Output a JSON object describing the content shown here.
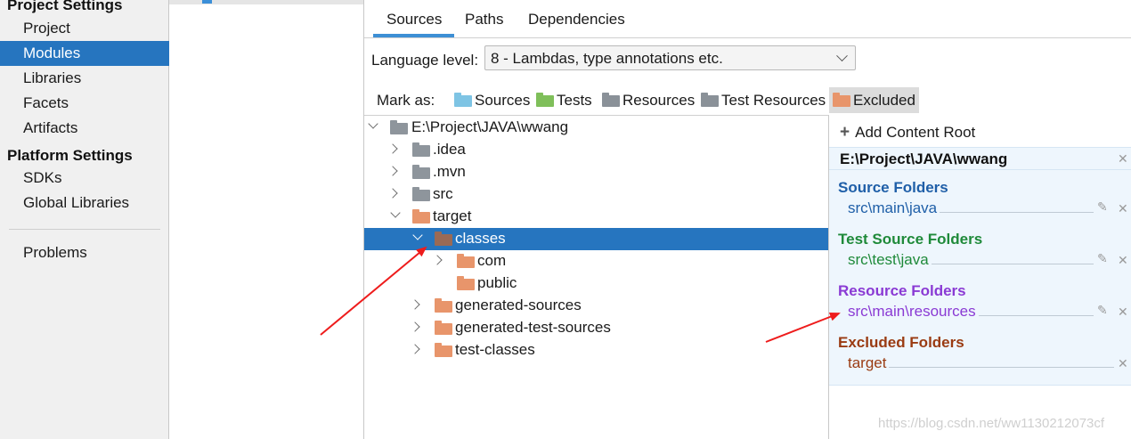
{
  "sidebar": {
    "project_settings_heading": "Project Settings",
    "project_settings_items": [
      "Project",
      "Modules",
      "Libraries",
      "Facets",
      "Artifacts"
    ],
    "platform_settings_heading": "Platform Settings",
    "platform_settings_items": [
      "SDKs",
      "Global Libraries"
    ],
    "problems": "Problems",
    "selected": "Modules"
  },
  "tabs": [
    "Sources",
    "Paths",
    "Dependencies"
  ],
  "active_tab": "Sources",
  "language_level": {
    "label": "Language level:",
    "value": "8 - Lambdas, type annotations etc."
  },
  "mark_as": {
    "label": "Mark as:",
    "buttons": [
      {
        "label": "Sources",
        "color": "#7ec4e4"
      },
      {
        "label": "Tests",
        "color": "#7fbf5a"
      },
      {
        "label": "Resources",
        "color": "#8a9198"
      },
      {
        "label": "Test Resources",
        "color": "#8a9198"
      },
      {
        "label": "Excluded",
        "color": "#e8956b"
      }
    ],
    "active": "Excluded"
  },
  "tree": {
    "root": "E:\\Project\\JAVA\\wwang",
    "items": [
      ".idea",
      ".mvn",
      "src",
      "target",
      "classes",
      "com",
      "public",
      "generated-sources",
      "generated-test-sources",
      "test-classes"
    ],
    "selected": "classes"
  },
  "content_roots": {
    "add_label": "Add Content Root",
    "root_path": "E:\\Project\\JAVA\\wwang",
    "sections": [
      {
        "title": "Source Folders",
        "path": "src\\main\\java",
        "color": "#1f5fa8"
      },
      {
        "title": "Test Source Folders",
        "path": "src\\test\\java",
        "color": "#1f8a3a"
      },
      {
        "title": "Resource Folders",
        "path": "src\\main\\resources",
        "color": "#8a3ad4"
      },
      {
        "title": "Excluded Folders",
        "path": "target",
        "color": "#9a3b12"
      }
    ]
  },
  "colors": {
    "selection": "#2675bf",
    "folder_gray": "#8e959c",
    "folder_orange": "#e8956b",
    "annotation_arrow": "#ee1c1c"
  },
  "watermark": "https://blog.csdn.net/ww1130212073cf"
}
